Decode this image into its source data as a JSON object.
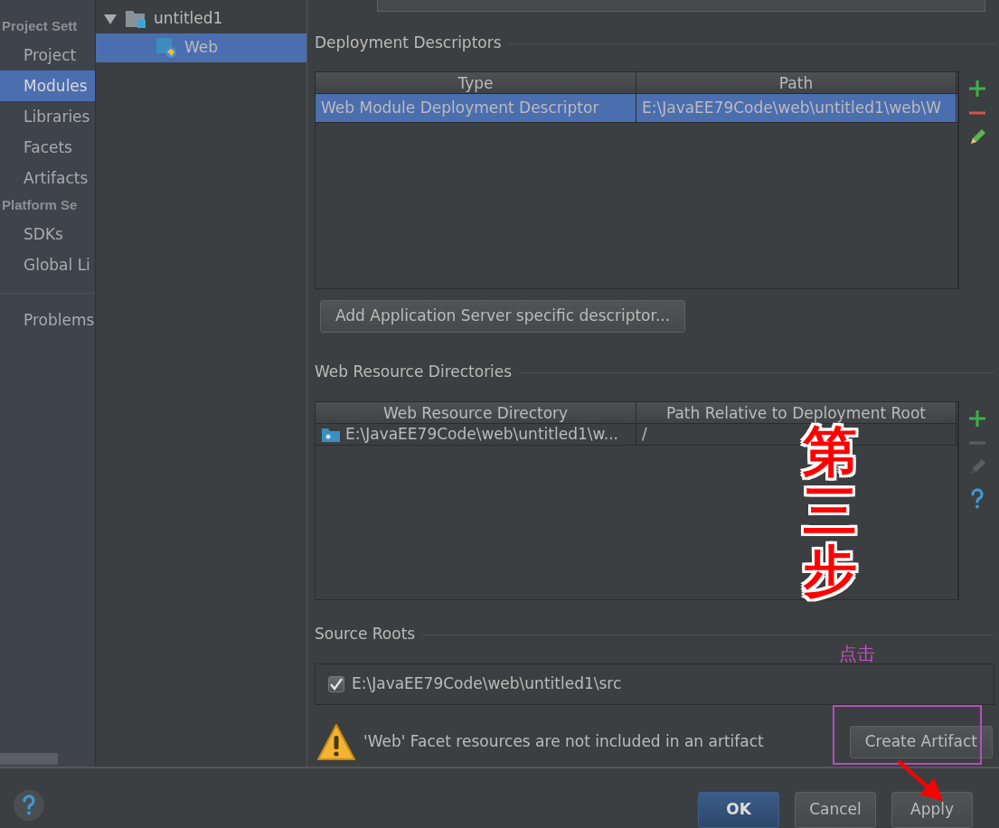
{
  "sidebar": {
    "groups": [
      {
        "title": "Project Sett",
        "items": [
          {
            "label": "Project",
            "selected": false
          },
          {
            "label": "Modules",
            "selected": true
          },
          {
            "label": "Libraries",
            "selected": false
          },
          {
            "label": "Facets",
            "selected": false
          },
          {
            "label": "Artifacts",
            "selected": false
          }
        ]
      },
      {
        "title": "Platform Se",
        "items": [
          {
            "label": "SDKs",
            "selected": false
          },
          {
            "label": "Global Li",
            "selected": false
          }
        ]
      }
    ],
    "footer_items": [
      {
        "label": "Problems",
        "selected": false
      }
    ]
  },
  "tree": [
    {
      "label": "untitled1",
      "expanded": true,
      "selected": false,
      "children": [
        {
          "label": "Web",
          "selected": true
        }
      ]
    }
  ],
  "deployment_descriptors": {
    "title": "Deployment Descriptors",
    "columns": [
      "Type",
      "Path"
    ],
    "rows": [
      {
        "cells": [
          "Web Module Deployment Descriptor",
          "E:\\JavaEE79Code\\web\\untitled1\\web\\W"
        ],
        "selected": true
      }
    ],
    "tools": [
      {
        "kind": "add",
        "disabled": false
      },
      {
        "kind": "remove",
        "disabled": false
      },
      {
        "kind": "edit",
        "disabled": false
      }
    ]
  },
  "add_descriptor_button": "Add Application Server specific descriptor...",
  "web_resource_directories": {
    "title": "Web Resource Directories",
    "columns": [
      "Web Resource Directory",
      "Path Relative to Deployment Root"
    ],
    "rows": [
      {
        "cells": [
          "E:\\JavaEE79Code\\web\\untitled1\\w...",
          "/"
        ],
        "selected": false
      }
    ],
    "tools": [
      {
        "kind": "add",
        "disabled": false
      },
      {
        "kind": "remove",
        "disabled": true
      },
      {
        "kind": "edit",
        "disabled": true
      },
      {
        "kind": "help",
        "disabled": false
      }
    ]
  },
  "source_roots": {
    "title": "Source Roots",
    "items": [
      {
        "path": "E:\\JavaEE79Code\\web\\untitled1\\src",
        "checked": true
      }
    ]
  },
  "warning": {
    "message": "'Web' Facet resources are not included in an artifact",
    "button": "Create Artifact"
  },
  "buttons": [
    {
      "label": "OK",
      "default": true
    },
    {
      "label": "Cancel",
      "default": false
    },
    {
      "label": "Apply",
      "default": false
    }
  ],
  "annotations": {
    "step": "第三步",
    "click": "点击"
  }
}
